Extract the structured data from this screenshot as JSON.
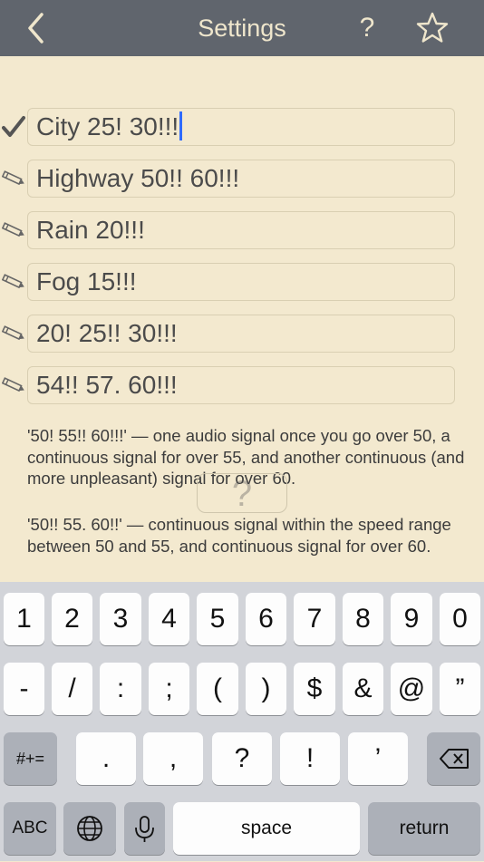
{
  "nav": {
    "title": "Settings",
    "help_label": "?"
  },
  "profiles": [
    {
      "text": "City 25! 30!!!",
      "marker": "checkmark-icon",
      "active": true
    },
    {
      "text": "Highway 50!! 60!!!",
      "marker": "pencil-icon"
    },
    {
      "text": "Rain 20!!!",
      "marker": "pencil-icon"
    },
    {
      "text": "Fog 15!!!",
      "marker": "pencil-icon"
    },
    {
      "text": "20! 25!! 30!!!",
      "marker": "pencil-icon"
    },
    {
      "text": "54!! 57. 60!!!",
      "marker": "pencil-icon"
    }
  ],
  "help": {
    "paragraph1": "'50! 55!! 60!!!' — one audio signal once you go over 50, a continuous signal for over 55, and another continuous (and more unpleasant) signal for over 60.",
    "paragraph2": "'50!! 55. 60!!' — continuous signal within the speed range between 50 and 55, and continuous signal for over 60.",
    "floating_help": "?"
  },
  "keyboard": {
    "row1": [
      "1",
      "2",
      "3",
      "4",
      "5",
      "6",
      "7",
      "8",
      "9",
      "0"
    ],
    "row2": [
      "-",
      "/",
      ":",
      ";",
      "(",
      ")",
      "$",
      "&",
      "@",
      "”"
    ],
    "row3_left": "#+=",
    "row3": [
      ".",
      ",",
      "?",
      "!",
      "’"
    ],
    "abc": "ABC",
    "space": "space",
    "return": "return"
  },
  "colors": {
    "background": "#f3e9cf",
    "navbar": "#60656d",
    "caret": "#2f6bff",
    "keyboard": "#d2d4d9"
  }
}
